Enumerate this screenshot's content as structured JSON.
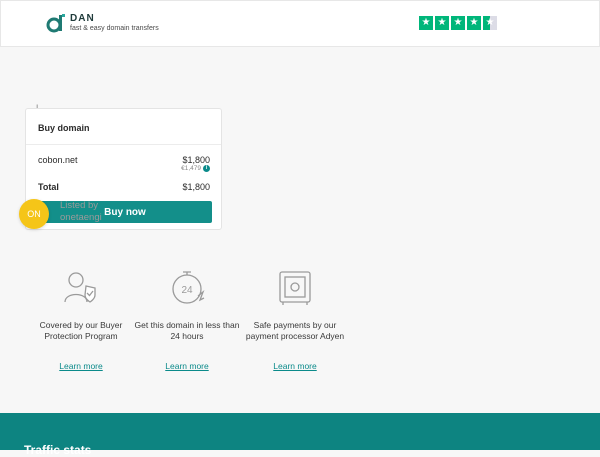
{
  "header": {
    "brand_name": "DAN",
    "tagline": "fast & easy domain transfers",
    "rating_stars": 4.5,
    "accent_color": "#00b67a"
  },
  "background_text": "L. . .",
  "card": {
    "title": "Buy domain",
    "domain": "cobon.net",
    "price_usd": "$1,800",
    "price_eur": "€1,479",
    "total_label": "Total",
    "total_value": "$1,800",
    "buy_button": "Buy now",
    "button_color": "#138f8a"
  },
  "seller": {
    "badge": "ON",
    "listed_by": "Listed by",
    "name": "onetaengi",
    "badge_color": "#f5c518"
  },
  "features": [
    {
      "icon": "shield-person-icon",
      "text": "Covered by our Buyer Protection Program",
      "link": "Learn more"
    },
    {
      "icon": "24h-clock-icon",
      "text": "Get this domain in less than 24 hours",
      "link": "Learn more"
    },
    {
      "icon": "safe-icon",
      "text": "Safe payments by our payment processor Adyen",
      "link": "Learn more"
    }
  ],
  "footer": {
    "text": "Traffic stats",
    "color": "#0d8481"
  }
}
